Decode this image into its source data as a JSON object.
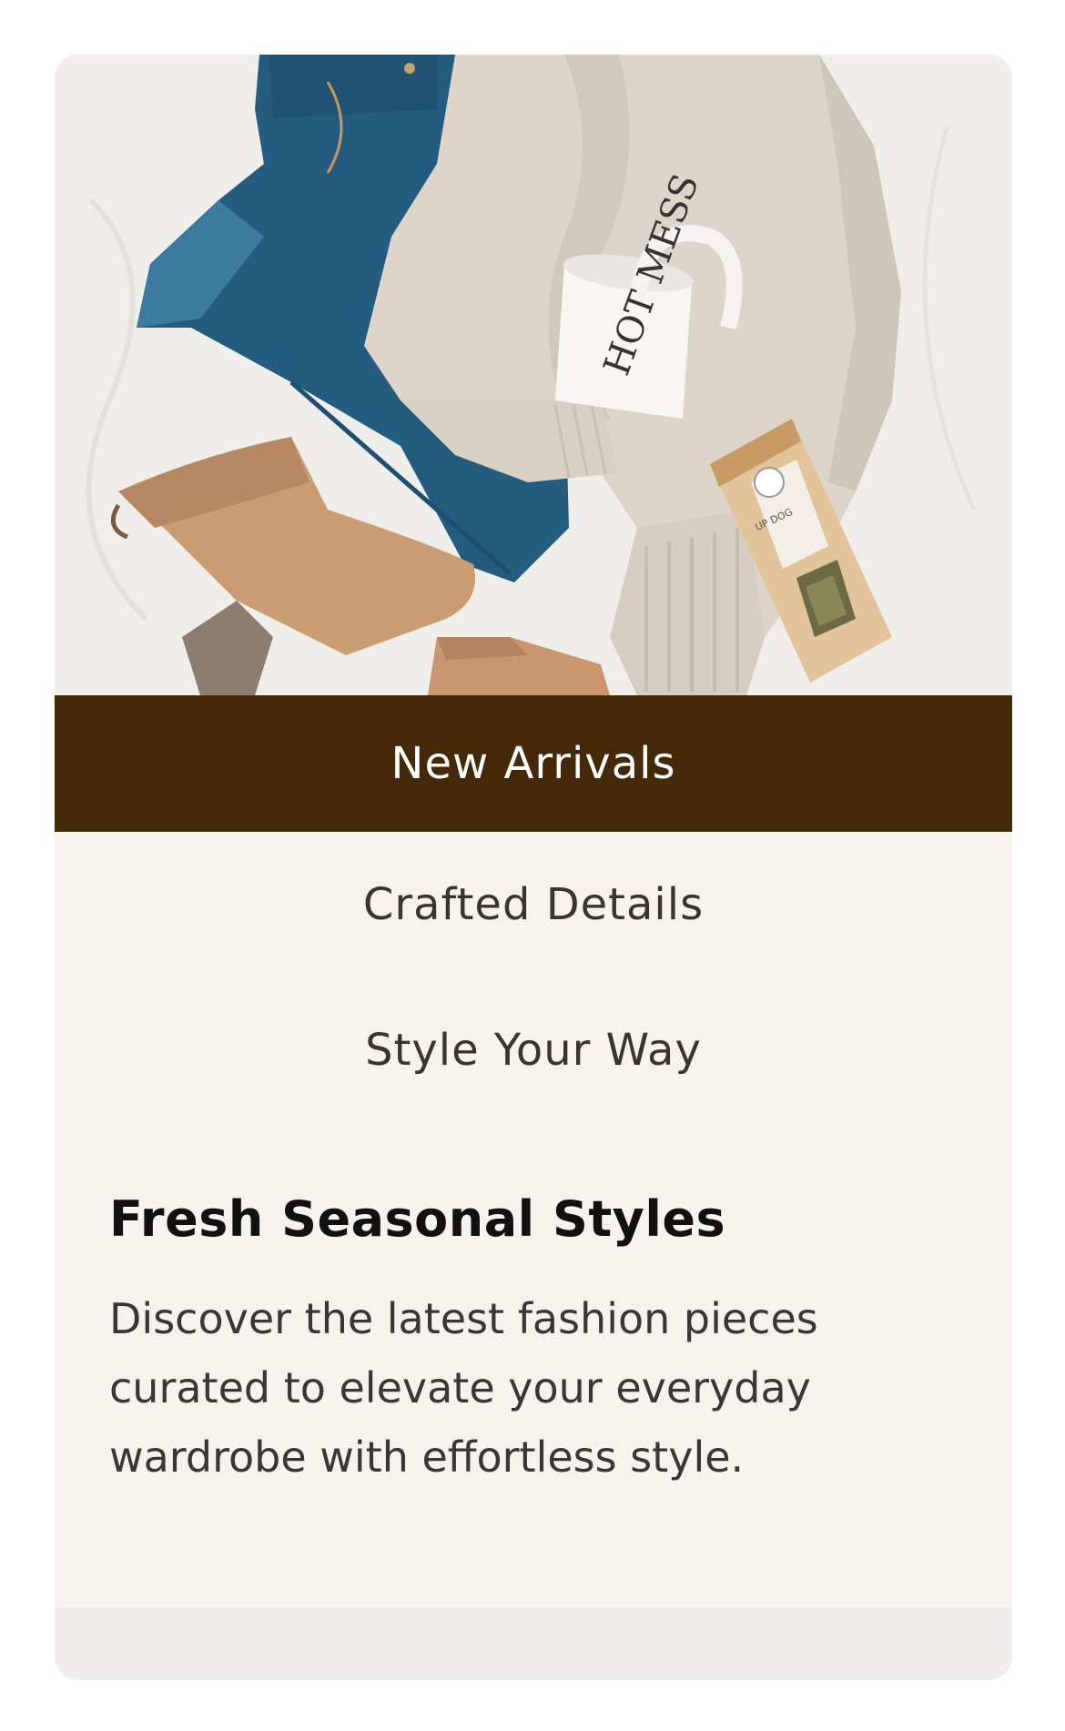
{
  "hero": {
    "image_alt": "Flat lay of jeans, knit sweater, suede ankle boots, mug and tea bag",
    "mug_text": "HOT MESS",
    "tea_label": "UP DOG"
  },
  "tabs": [
    {
      "label": "New Arrivals",
      "active": true
    },
    {
      "label": "Crafted Details",
      "active": false
    },
    {
      "label": "Style Your Way",
      "active": false
    }
  ],
  "content": {
    "heading": "Fresh Seasonal Styles",
    "description": "Discover the latest fashion pieces curated to elevate your everyday wardrobe with effortless style."
  },
  "colors": {
    "active_tab_bg": "#452808",
    "card_bg": "#f6f2ee"
  }
}
